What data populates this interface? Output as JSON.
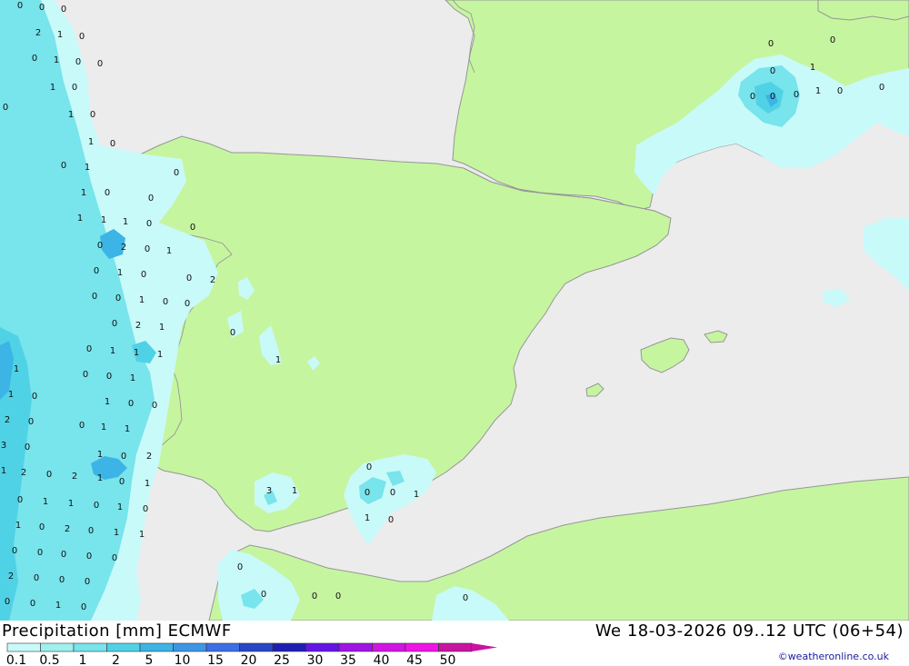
{
  "footer": {
    "title": "Precipitation [mm] ECMWF",
    "datetime": "We 18-03-2026 09..12 UTC (06+54)",
    "credit": "©weatheronline.co.uk"
  },
  "legend": {
    "ticks": [
      "0.1",
      "0.5",
      "1",
      "2",
      "5",
      "10",
      "15",
      "20",
      "25",
      "30",
      "35",
      "40",
      "45",
      "50"
    ],
    "colors": [
      "#c8fafa",
      "#a0f0f0",
      "#78e4ec",
      "#50d2e6",
      "#3cb4e6",
      "#3c96e6",
      "#3c6ee6",
      "#2846c8",
      "#1e1eb4",
      "#6414e6",
      "#a014e6",
      "#d214e6",
      "#f014e6",
      "#c814a0"
    ]
  },
  "colors": {
    "sea": "#ececec",
    "land": "#c6f5a0",
    "border": "#969696",
    "precip_light": "#c8fafa",
    "precip_mid": "#78e4ec",
    "precip_strong": "#3cb4e6",
    "precip_heavy": "#3c96e6"
  },
  "precip_labels": [
    {
      "t": "0"
    },
    {
      "t": "0"
    },
    {
      "t": "0"
    },
    {
      "t": "2"
    },
    {
      "t": "1"
    },
    {
      "t": "0"
    },
    {
      "t": "0"
    },
    {
      "t": "1"
    },
    {
      "t": "0"
    },
    {
      "t": "0"
    },
    {
      "t": "1"
    },
    {
      "t": "0"
    },
    {
      "t": "1"
    },
    {
      "t": "0"
    },
    {
      "t": "0"
    },
    {
      "t": "1"
    },
    {
      "t": "0"
    },
    {
      "t": "0"
    },
    {
      "t": "1"
    },
    {
      "t": "1"
    },
    {
      "t": "0"
    },
    {
      "t": "1"
    },
    {
      "t": "1"
    },
    {
      "t": "1"
    },
    {
      "t": "0"
    },
    {
      "t": "0"
    },
    {
      "t": "0"
    },
    {
      "t": "2"
    },
    {
      "t": "0"
    },
    {
      "t": "1"
    },
    {
      "t": "0"
    },
    {
      "t": "1"
    },
    {
      "t": "0"
    },
    {
      "t": "0"
    },
    {
      "t": "2"
    },
    {
      "t": "0"
    },
    {
      "t": "0"
    },
    {
      "t": "1"
    },
    {
      "t": "0"
    },
    {
      "t": "0"
    },
    {
      "t": "0"
    },
    {
      "t": "2"
    },
    {
      "t": "1"
    },
    {
      "t": "0"
    },
    {
      "t": "1"
    },
    {
      "t": "1"
    },
    {
      "t": "1"
    },
    {
      "t": "0"
    },
    {
      "t": "0"
    },
    {
      "t": "1"
    },
    {
      "t": "1"
    },
    {
      "t": "0"
    },
    {
      "t": "0"
    },
    {
      "t": "0"
    },
    {
      "t": "1"
    },
    {
      "t": "1"
    },
    {
      "t": "0"
    },
    {
      "t": "1"
    },
    {
      "t": "1"
    },
    {
      "t": "0"
    },
    {
      "t": "2"
    },
    {
      "t": "3"
    },
    {
      "t": "0"
    },
    {
      "t": "1"
    },
    {
      "t": "2"
    },
    {
      "t": "0"
    },
    {
      "t": "2"
    },
    {
      "t": "1"
    },
    {
      "t": "0"
    },
    {
      "t": "2"
    },
    {
      "t": "1"
    },
    {
      "t": "0"
    },
    {
      "t": "1"
    },
    {
      "t": "0"
    },
    {
      "t": "1"
    },
    {
      "t": "1"
    },
    {
      "t": "0"
    },
    {
      "t": "1"
    },
    {
      "t": "0"
    },
    {
      "t": "1"
    },
    {
      "t": "0"
    },
    {
      "t": "2"
    },
    {
      "t": "0"
    },
    {
      "t": "1"
    },
    {
      "t": "1"
    },
    {
      "t": "0"
    },
    {
      "t": "0"
    },
    {
      "t": "0"
    },
    {
      "t": "0"
    },
    {
      "t": "0"
    },
    {
      "t": "2"
    },
    {
      "t": "0"
    },
    {
      "t": "0"
    },
    {
      "t": "0"
    },
    {
      "t": "0"
    },
    {
      "t": "0"
    },
    {
      "t": "1"
    },
    {
      "t": "0"
    },
    {
      "t": "0"
    },
    {
      "t": "0"
    },
    {
      "t": "0"
    },
    {
      "t": "1"
    },
    {
      "t": "3"
    },
    {
      "t": "1"
    },
    {
      "t": "0"
    },
    {
      "t": "0"
    },
    {
      "t": "0"
    },
    {
      "t": "1"
    },
    {
      "t": "1"
    },
    {
      "t": "0"
    },
    {
      "t": "0"
    },
    {
      "t": "0"
    },
    {
      "t": "0"
    },
    {
      "t": "0"
    },
    {
      "t": "0"
    },
    {
      "t": "0"
    },
    {
      "t": "0"
    },
    {
      "t": "0"
    },
    {
      "t": "1"
    },
    {
      "t": "0"
    },
    {
      "t": "0"
    },
    {
      "t": "0"
    },
    {
      "t": "1"
    },
    {
      "t": "0"
    },
    {
      "t": "0"
    }
  ]
}
